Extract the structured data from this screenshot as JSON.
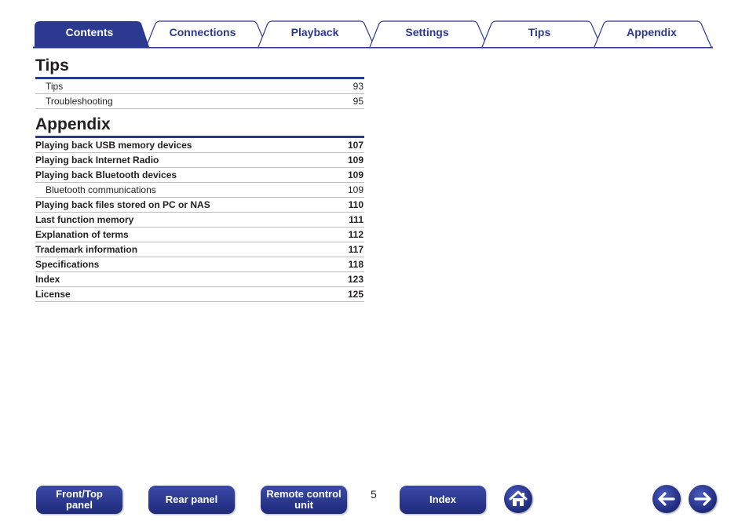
{
  "tabs": [
    {
      "label": "Contents",
      "active": true
    },
    {
      "label": "Connections",
      "active": false
    },
    {
      "label": "Playback",
      "active": false
    },
    {
      "label": "Settings",
      "active": false
    },
    {
      "label": "Tips",
      "active": false
    },
    {
      "label": "Appendix",
      "active": false
    }
  ],
  "tips": {
    "title": "Tips",
    "items": [
      {
        "label": "Tips",
        "page": "93"
      },
      {
        "label": "Troubleshooting",
        "page": "95"
      }
    ]
  },
  "appendix": {
    "title": "Appendix",
    "items": [
      {
        "label": "Playing back USB memory devices",
        "page": "107",
        "level": "main"
      },
      {
        "label": "Playing back Internet Radio",
        "page": "109",
        "level": "main"
      },
      {
        "label": "Playing back Bluetooth devices",
        "page": "109",
        "level": "main"
      },
      {
        "label": "Bluetooth communications",
        "page": "109",
        "level": "sub"
      },
      {
        "label": "Playing back files stored on PC or NAS",
        "page": "110",
        "level": "main"
      },
      {
        "label": "Last function memory",
        "page": "111",
        "level": "main"
      },
      {
        "label": "Explanation of terms",
        "page": "112",
        "level": "main"
      },
      {
        "label": "Trademark information",
        "page": "117",
        "level": "main"
      },
      {
        "label": "Specifications",
        "page": "118",
        "level": "main"
      },
      {
        "label": "Index",
        "page": "123",
        "level": "main"
      },
      {
        "label": "License",
        "page": "125",
        "level": "main"
      }
    ]
  },
  "footer": {
    "front_top_panel": "Front/Top\npanel",
    "rear_panel": "Rear panel",
    "remote_control_unit": "Remote control\nunit",
    "page_number": "5",
    "index": "Index"
  },
  "colors": {
    "accent": "#2b3990",
    "text": "#231f20",
    "rule": "#bcbec0"
  },
  "icons": [
    "home-icon",
    "back-arrow-icon",
    "forward-arrow-icon"
  ]
}
